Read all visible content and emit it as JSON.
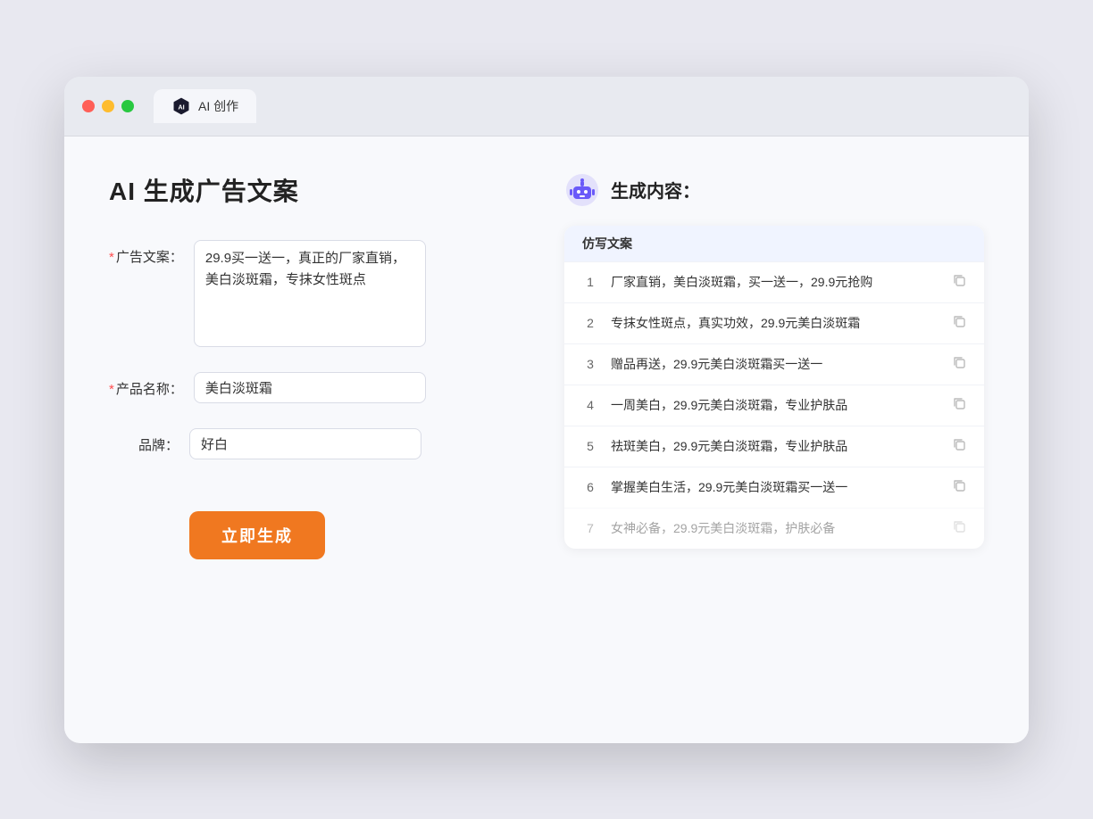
{
  "window": {
    "tab_label": "AI 创作"
  },
  "left": {
    "title": "AI 生成广告文案",
    "fields": [
      {
        "label": "广告文案：",
        "required": true,
        "type": "textarea",
        "name": "ad-copy-field",
        "value": "29.9买一送一，真正的厂家直销，美白淡斑霜，专抹女性斑点"
      },
      {
        "label": "产品名称：",
        "required": true,
        "type": "input",
        "name": "product-name-field",
        "value": "美白淡斑霜"
      },
      {
        "label": "品牌：",
        "required": false,
        "type": "input",
        "name": "brand-field",
        "value": "好白"
      }
    ],
    "button_label": "立即生成"
  },
  "right": {
    "title": "生成内容：",
    "table_header": "仿写文案",
    "rows": [
      {
        "num": "1",
        "text": "厂家直销，美白淡斑霜，买一送一，29.9元抢购",
        "faded": false
      },
      {
        "num": "2",
        "text": "专抹女性斑点，真实功效，29.9元美白淡斑霜",
        "faded": false
      },
      {
        "num": "3",
        "text": "赠品再送，29.9元美白淡斑霜买一送一",
        "faded": false
      },
      {
        "num": "4",
        "text": "一周美白，29.9元美白淡斑霜，专业护肤品",
        "faded": false
      },
      {
        "num": "5",
        "text": "祛斑美白，29.9元美白淡斑霜，专业护肤品",
        "faded": false
      },
      {
        "num": "6",
        "text": "掌握美白生活，29.9元美白淡斑霜买一送一",
        "faded": false
      },
      {
        "num": "7",
        "text": "女神必备，29.9元美白淡斑霜，护肤必备",
        "faded": true
      }
    ]
  },
  "colors": {
    "accent": "#f07820",
    "required": "#ff4d4f",
    "tab_icon_bg": "#1a1a2e"
  }
}
